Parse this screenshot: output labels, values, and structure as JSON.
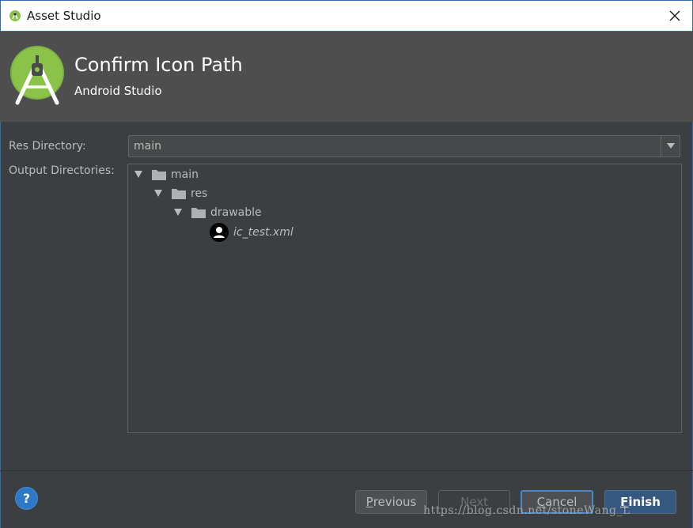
{
  "window": {
    "title": "Asset Studio",
    "icon": "android-icon",
    "close_icon": "close-icon"
  },
  "header": {
    "title": "Confirm Icon Path",
    "subtitle": "Android Studio",
    "logo": "android-studio-logo"
  },
  "form": {
    "res_directory_label": "Res Directory:",
    "res_directory_value": "main",
    "output_directories_label": "Output Directories:"
  },
  "tree": [
    {
      "label": "main",
      "type": "folder",
      "expanded": true,
      "depth": 0
    },
    {
      "label": "res",
      "type": "folder",
      "expanded": true,
      "depth": 1
    },
    {
      "label": "drawable",
      "type": "folder",
      "expanded": true,
      "depth": 2
    },
    {
      "label": "ic_test.xml",
      "type": "file",
      "depth": 3
    }
  ],
  "footer": {
    "help_label": "?",
    "buttons": {
      "previous": {
        "first": "P",
        "rest": "revious",
        "enabled": true
      },
      "next": {
        "label": "Next",
        "enabled": false
      },
      "cancel": {
        "first": "C",
        "rest": "ancel",
        "enabled": true
      },
      "finish": {
        "first": "F",
        "rest": "inish",
        "enabled": true
      }
    }
  },
  "watermark": "https://blog.csdn.net/stoneWang_L",
  "colors": {
    "accent": "#365880",
    "background": "#3c3f41",
    "header": "#4e4e4e",
    "help": "#2d79c7",
    "android_green": "#8bc34a"
  }
}
